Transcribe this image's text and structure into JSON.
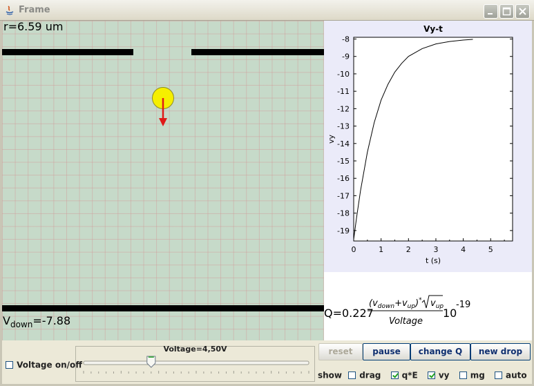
{
  "window": {
    "title": "Frame",
    "buttons": [
      "minimize",
      "maximize",
      "close"
    ]
  },
  "simulation": {
    "radius_label": "r=6.59 um",
    "vdown_prefix": "V",
    "vdown_sub": "down",
    "vdown_value": "=-7.88",
    "drop_color": "#f5ef00",
    "force_arrow_color": "#e01818"
  },
  "chart_data": {
    "type": "line",
    "title": "Vy-t",
    "xlabel": "t (s)",
    "ylabel": "vy",
    "xlim": [
      0,
      5.8
    ],
    "ylim": [
      -19.6,
      -7.9
    ],
    "xticks": [
      0,
      1,
      2,
      3,
      4,
      5
    ],
    "yticks": [
      -8,
      -9,
      -10,
      -11,
      -12,
      -13,
      -14,
      -15,
      -16,
      -17,
      -18,
      -19
    ],
    "grid": false,
    "series": [
      {
        "values_x": [
          0,
          0.1,
          0.25,
          0.5,
          0.75,
          1.0,
          1.25,
          1.5,
          1.75,
          2.0,
          2.5,
          3.0,
          3.5,
          4.0,
          4.35
        ],
        "values_y": [
          -19.5,
          -18.3,
          -16.7,
          -14.5,
          -12.8,
          -11.5,
          -10.6,
          -9.9,
          -9.4,
          -9.0,
          -8.55,
          -8.28,
          -8.14,
          -8.06,
          -8.02
        ]
      }
    ]
  },
  "formula": {
    "prefix": "Q=0.227",
    "numerator_open": "(v",
    "v_down": "down",
    "plus": "+v",
    "v_up": "up",
    "close": ")",
    "star": "*",
    "sqrt_v": "v",
    "sqrt_sub": "up",
    "denominator": "Voltage",
    "ten": "10",
    "exponent": "-19"
  },
  "controls": {
    "voltage_toggle_label": "Voltage on/off",
    "slider_title": "Voltage=4,50V",
    "slider_value_fraction": 0.3,
    "buttons": {
      "reset": "reset",
      "pause": "pause",
      "change_q": "change Q",
      "new_drop": "new drop"
    },
    "show_label": "show",
    "options": [
      {
        "label": "drag",
        "checked": false
      },
      {
        "label": "q*E",
        "checked": true
      },
      {
        "label": "vy",
        "checked": true
      },
      {
        "label": "mg",
        "checked": false
      },
      {
        "label": "auto",
        "checked": false
      },
      {
        "label": "",
        "checked": false
      }
    ]
  }
}
